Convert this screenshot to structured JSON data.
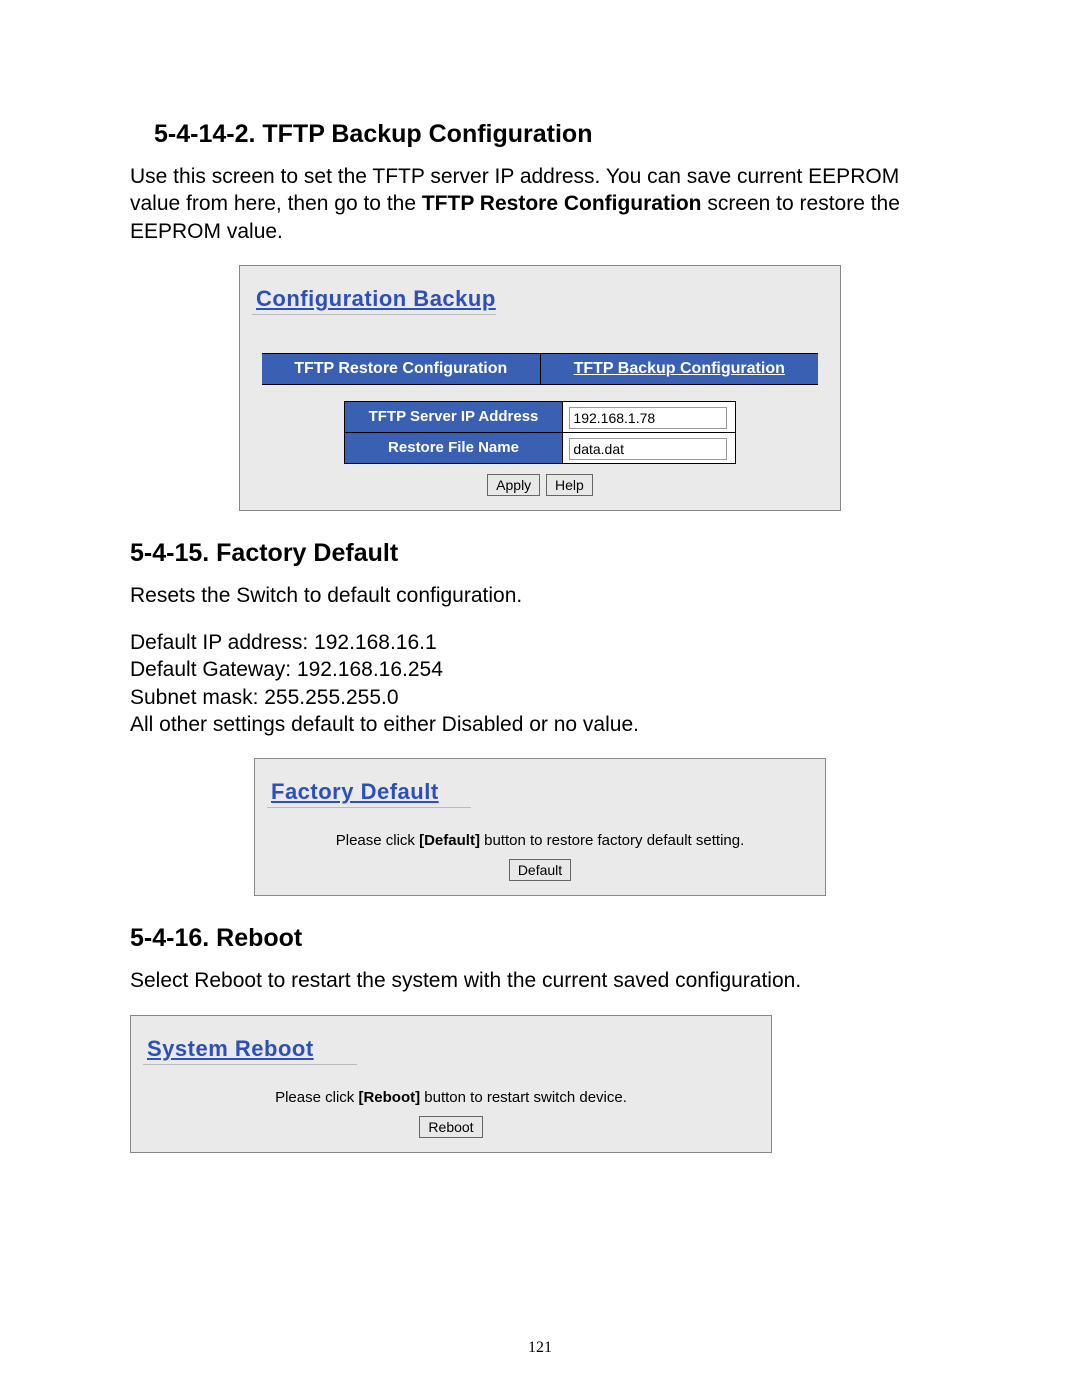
{
  "sections": {
    "tftp": {
      "heading": "5-4-14-2. TFTP Backup Configuration",
      "body_pre": "Use this screen to set the TFTP server IP address. You can save current EEPROM value from here, then go to the ",
      "body_bold": "TFTP Restore Configuration",
      "body_post": " screen to restore the EEPROM value."
    },
    "factory": {
      "heading": "5-4-15. Factory Default",
      "lines": {
        "l1": "Resets the Switch to default configuration.",
        "l2": "Default IP address: 192.168.16.1",
        "l3": "Default Gateway: 192.168.16.254",
        "l4": "Subnet mask: 255.255.255.0",
        "l5": "All other settings default to either Disabled or no value."
      }
    },
    "reboot": {
      "heading": "5-4-16. Reboot",
      "body": "Select Reboot to restart the system with the current saved configuration."
    }
  },
  "panels": {
    "config": {
      "title": "Configuration Backup",
      "tabs": {
        "restore": "TFTP Restore Configuration",
        "backup": "TFTP Backup Configuration"
      },
      "fields": {
        "ip_label": "TFTP Server IP Address",
        "ip_value": "192.168.1.78",
        "file_label": "Restore File Name",
        "file_value": "data.dat"
      },
      "buttons": {
        "apply": "Apply",
        "help": "Help"
      }
    },
    "factory": {
      "title": "Factory Default",
      "instr_pre": "Please click ",
      "instr_bold": "[Default]",
      "instr_post": " button to restore factory default setting.",
      "button": "Default"
    },
    "reboot": {
      "title": "System Reboot",
      "instr_pre": "Please click ",
      "instr_bold": "[Reboot]",
      "instr_post": " button to restart switch device.",
      "button": "Reboot"
    }
  },
  "page_number": "121"
}
